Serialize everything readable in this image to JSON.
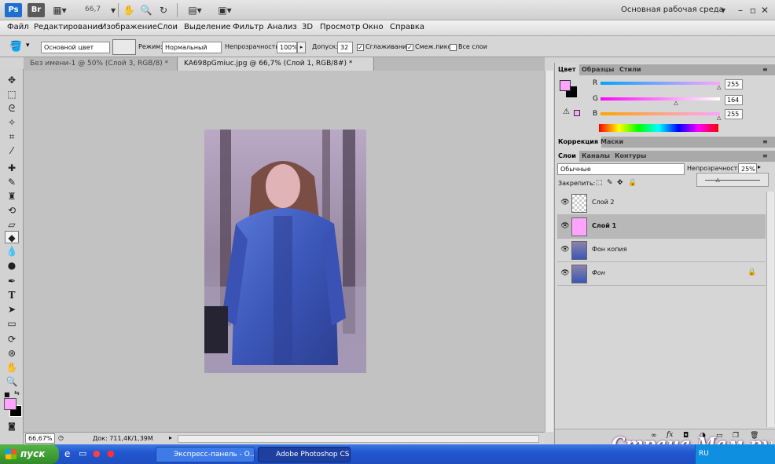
{
  "appbar": {
    "ps_logo": "Ps",
    "br_logo": "Br",
    "zoom": "66,7",
    "workspace": "Основная рабочая среда",
    "colors": {
      "ps_logo": "#1f6fd1",
      "br_logo": "#5a5a5a"
    }
  },
  "menu": [
    "Файл",
    "Редактирование",
    "Изображение",
    "Слои",
    "Выделение",
    "Фильтр",
    "Анализ",
    "3D",
    "Просмотр",
    "Окно",
    "Справка"
  ],
  "options": {
    "fill_source": "Основной цвет",
    "mode_label": "Режим:",
    "mode_value": "Нормальный",
    "opacity_label": "Непрозрачность:",
    "opacity_value": "100%",
    "tolerance_label": "Допуск:",
    "tolerance_value": "32",
    "antialias_label": "Сглаживание",
    "contiguous_label": "Смеж.пикс",
    "all_layers_label": "Все слои"
  },
  "tabs": [
    {
      "label": "Без имени-1 @ 50% (Слой 3, RGB/8) *"
    },
    {
      "label": "KA698pGmiuc.jpg @ 66,7% (Слой 1, RGB/8#) *"
    }
  ],
  "status": {
    "zoom": "66,67%",
    "doc": "Док: 711,4K/1,39M"
  },
  "color_panel": {
    "tabs": [
      "Цвет",
      "Образцы",
      "Стили"
    ],
    "r_label": "R",
    "g_label": "G",
    "b_label": "B",
    "r": "255",
    "g": "164",
    "b": "255",
    "r_level": 1.0,
    "g_level": 0.64,
    "b_level": 1.0,
    "foreground": "#ffa4ff",
    "background": "#000000"
  },
  "adjust_panel": {
    "tabs": [
      "Коррекция",
      "Маски"
    ]
  },
  "layers_panel": {
    "tabs": [
      "Слои",
      "Каналы",
      "Контуры"
    ],
    "blend_mode": "Обычные",
    "opacity_label": "Непрозрачность:",
    "opacity_value": "25%",
    "lock_label": "Закрепить:",
    "layers": [
      {
        "name": "Слой 2",
        "selected": false
      },
      {
        "name": "Слой 1",
        "selected": true
      },
      {
        "name": "Фон копия",
        "selected": false
      },
      {
        "name": "Фон",
        "selected": false
      }
    ]
  },
  "taskbar": {
    "start": "пуск",
    "tasks": [
      "Экспресс-панель - О...",
      "Adobe Photoshop CS..."
    ],
    "lang": "RU"
  },
  "watermark": "Страна Мам.ру"
}
